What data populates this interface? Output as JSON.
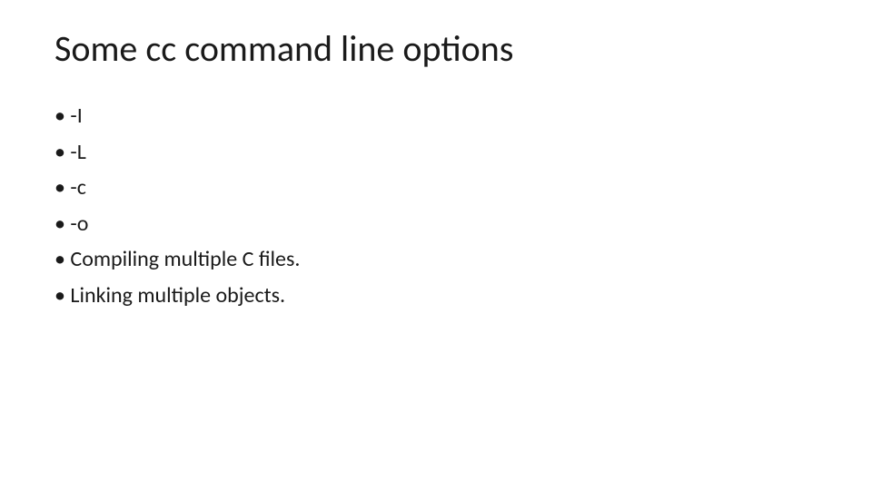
{
  "slide": {
    "title": "Some cc command line options",
    "bullets": [
      "-I",
      "-L",
      "-c",
      "-o",
      "Compiling multiple C files.",
      "Linking multiple objects."
    ]
  }
}
